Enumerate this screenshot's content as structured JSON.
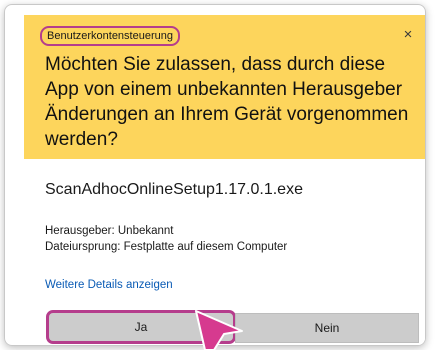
{
  "dialog": {
    "title": "Benutzerkontensteuerung",
    "close_label": "×",
    "question": "Möchten Sie zulassen, dass durch diese App von einem unbekannten Herausgeber Änderungen an Ihrem Gerät vorgenommen werden?",
    "file_name": "ScanAdhocOnlineSetup1.17.0.1.exe",
    "publisher": "Herausgeber: Unbekannt",
    "origin": "Dateiursprung: Festplatte auf diesem Computer",
    "more_details_link": "Weitere Details anzeigen",
    "yes_label": "Ja",
    "no_label": "Nein"
  },
  "colors": {
    "header_background": "#fdd55c",
    "highlight": "#b53d8c",
    "link": "#0a5bb5",
    "button_background": "#cccccc"
  },
  "icons": {
    "close": "close-icon",
    "pointer": "arrow-pointer-icon"
  }
}
